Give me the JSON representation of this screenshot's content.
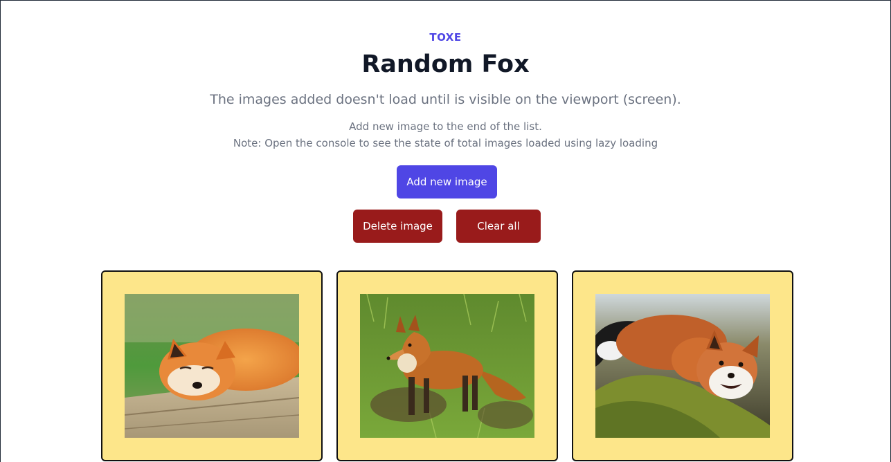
{
  "header": {
    "brand": "TOXE",
    "title": "Random Fox",
    "subtitle": "The images added doesn't load until is visible on the viewport (screen).",
    "note_line1": "Add new image to the end of the list.",
    "note_line2": "Note: Open the console to see the state of total images loaded using lazy loading"
  },
  "actions": {
    "add_label": "Add new image",
    "delete_label": "Delete image",
    "clear_label": "Clear all"
  },
  "colors": {
    "brand": "#4f46e5",
    "primary_button": "#4f46e5",
    "danger_button": "#991b1b",
    "card_background": "#fde68a"
  },
  "images": [
    {
      "subject": "sleeping fox on wooden plank"
    },
    {
      "subject": "red fox standing in grass"
    },
    {
      "subject": "smiling fox lying on moss"
    }
  ]
}
